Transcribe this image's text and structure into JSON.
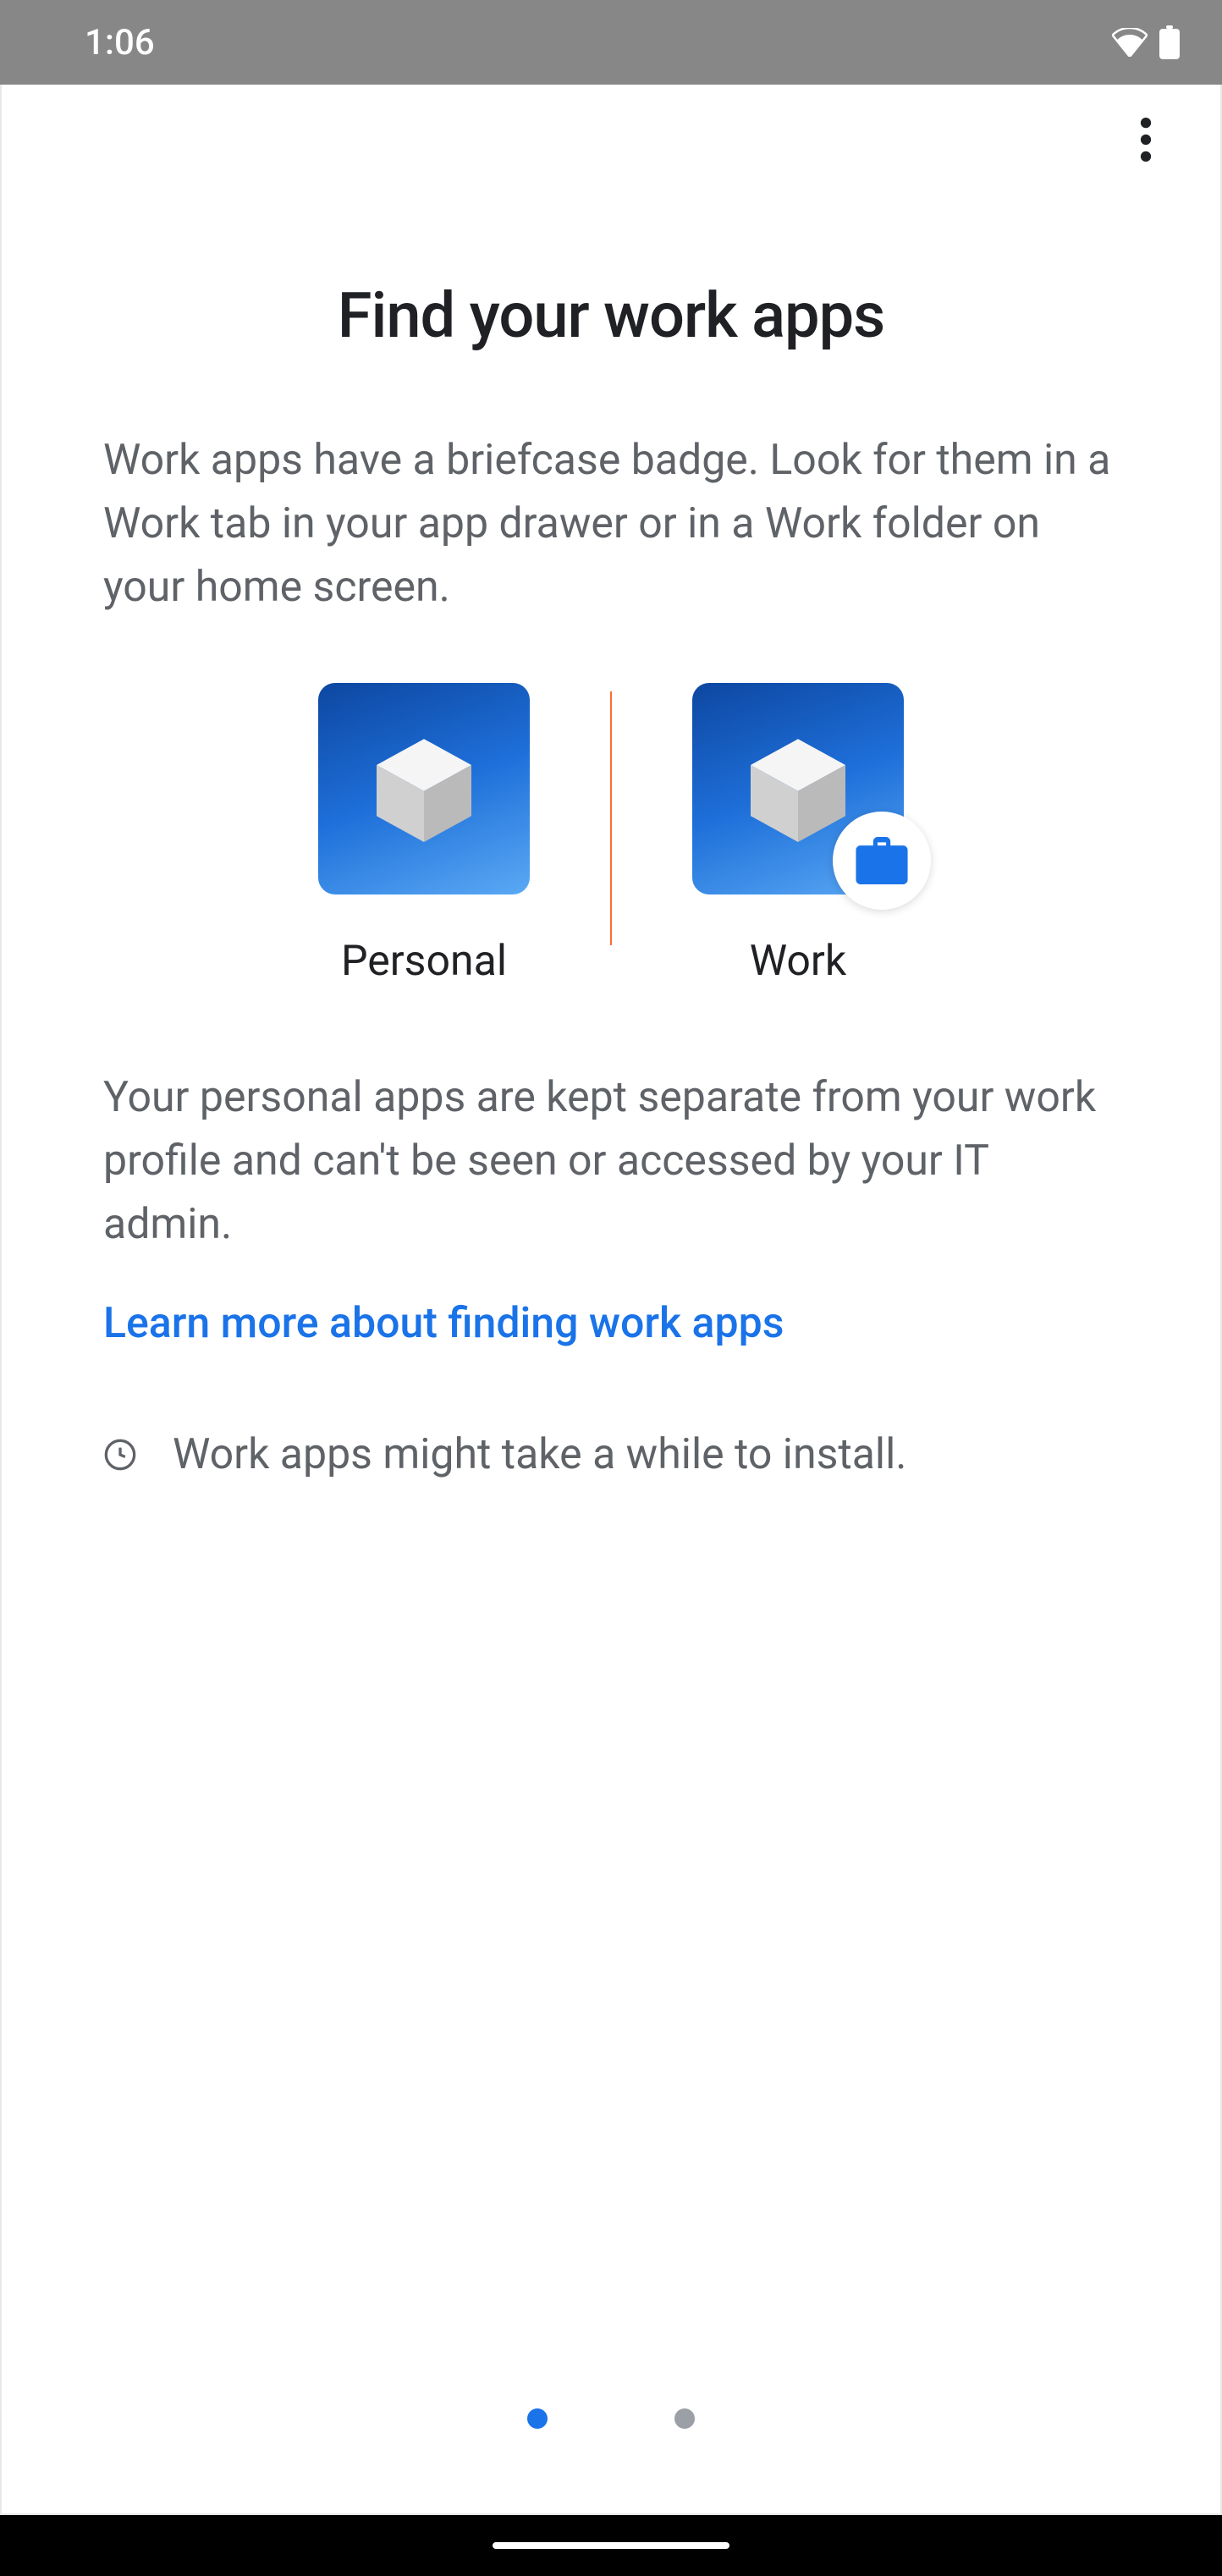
{
  "statusBar": {
    "time": "1:06"
  },
  "page": {
    "title": "Find your work apps",
    "description": "Work apps have a briefcase badge. Look for them in a Work tab in your app drawer or in a Work folder on your home screen.",
    "personalLabel": "Personal",
    "workLabel": "Work",
    "subtext": "Your personal apps are kept separate from your work profile and can't be seen or accessed by your IT admin.",
    "learnMore": "Learn more about finding work apps",
    "installNote": "Work apps might take a while to install."
  }
}
